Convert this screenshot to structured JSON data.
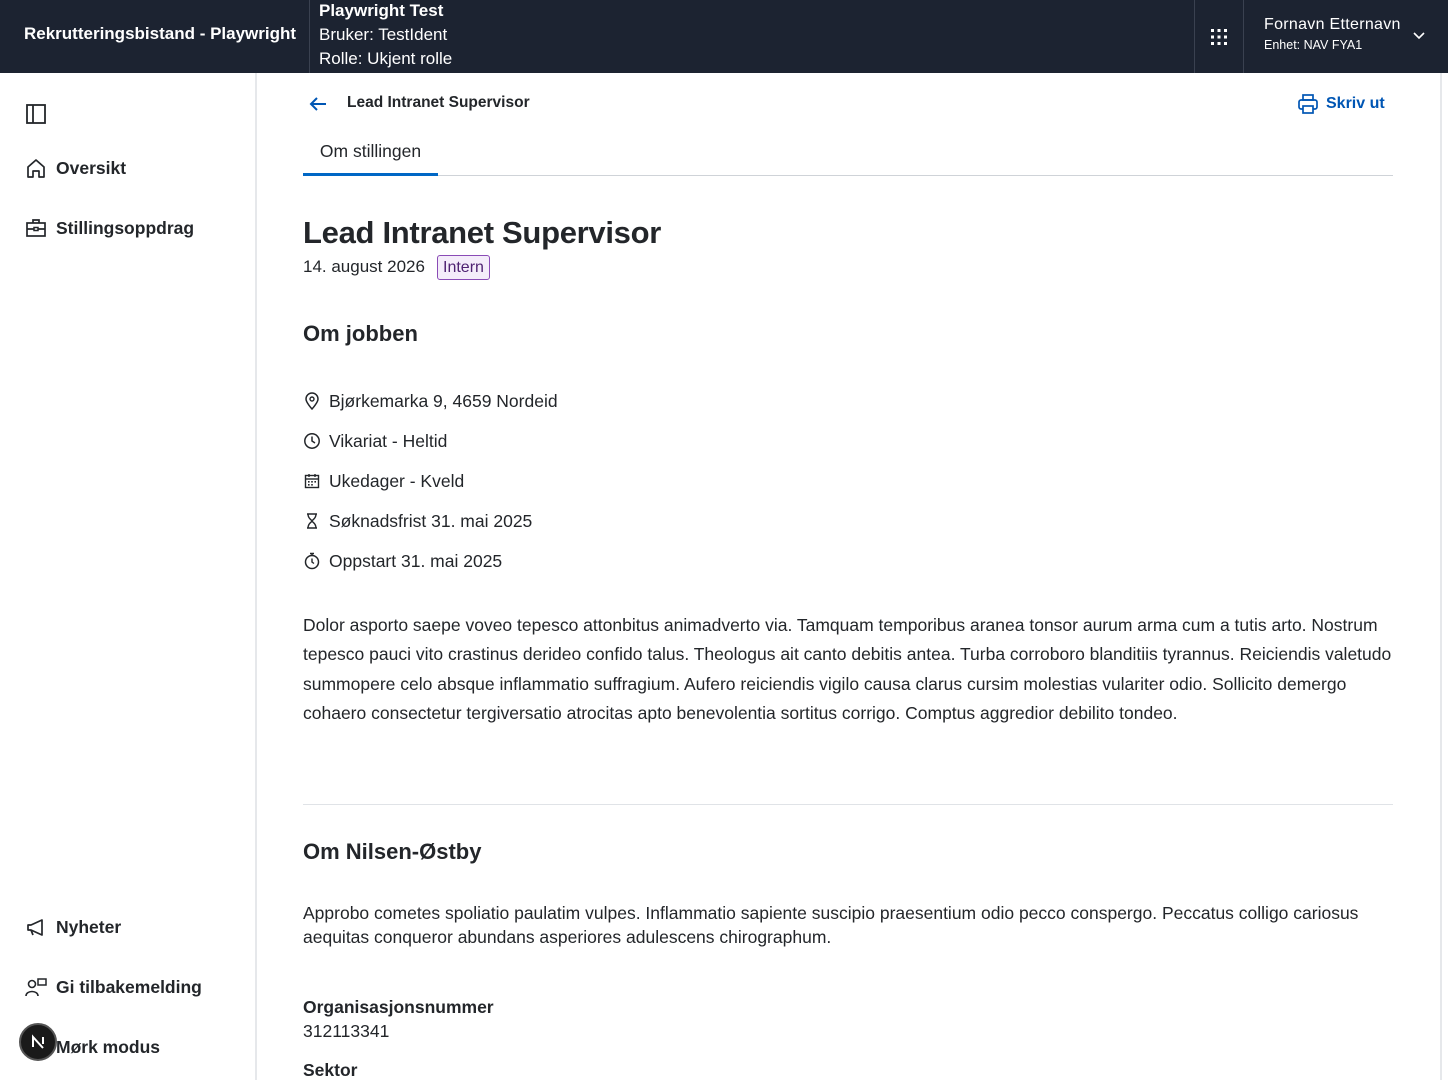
{
  "header": {
    "app_title": "Rekrutteringsbistand - Playwright",
    "env_title": "Playwright Test",
    "env_user": "Bruker: TestIdent",
    "env_role": "Rolle: Ukjent rolle",
    "user_name": "Fornavn Etternavn",
    "user_unit": "Enhet: NAV FYA1"
  },
  "sidebar": {
    "items": [
      {
        "label": "Oversikt",
        "icon": "house-icon"
      },
      {
        "label": "Stillingsoppdrag",
        "icon": "briefcase-icon"
      }
    ],
    "bottom_items": [
      {
        "label": "Nyheter",
        "icon": "megaphone-icon"
      },
      {
        "label": "Gi tilbakemelding",
        "icon": "feedback-icon"
      },
      {
        "label": "Mørk modus",
        "icon": "moon-icon"
      }
    ]
  },
  "main": {
    "breadcrumb_title": "Lead Intranet Supervisor",
    "print_label": "Skriv ut",
    "tabs": [
      {
        "label": "Om stillingen"
      }
    ],
    "job_title": "Lead Intranet Supervisor",
    "date": "14. august 2026",
    "tag": "Intern",
    "about_job_heading": "Om jobben",
    "facts": [
      {
        "icon": "location-pin-icon",
        "text": "Bjørkemarka 9, 4659 Nordeid"
      },
      {
        "icon": "clock-icon",
        "text": "Vikariat - Heltid"
      },
      {
        "icon": "calendar-icon",
        "text": "Ukedager - Kveld"
      },
      {
        "icon": "hourglass-icon",
        "text": "Søknadsfrist 31. mai 2025"
      },
      {
        "icon": "stopwatch-icon",
        "text": "Oppstart 31. mai 2025"
      }
    ],
    "description": "Dolor asporto saepe voveo tepesco attonbitus animadverto via. Tamquam temporibus aranea tonsor aurum arma cum a tutis arto. Nostrum tepesco pauci vito crastinus derideo confido talus. Theologus ait canto debitis antea. Turba corroboro blanditiis tyrannus. Reiciendis valetudo summopere celo absque inflammatio suffragium. Aufero reiciendis vigilo causa clarus cursim molestias vulariter odio. Sollicito demergo cohaero consectetur tergiversatio atrocitas apto benevolentia sortitus corrigo. Comptus aggredior debilito tondeo.",
    "company_heading": "Om Nilsen-Østby",
    "company_description": "Approbo cometes spoliatio paulatim vulpes. Inflammatio sapiente suscipio praesentium odio pecco conspergo. Peccatus colligo cariosus aequitas conqueror abundans asperiores adulescens chirographum.",
    "org_number_label": "Organisasjonsnummer",
    "org_number_value": "312113341",
    "sector_label": "Sektor"
  },
  "colors": {
    "header_bg": "#1c2331",
    "accent": "#0067c5",
    "link": "#0056b4",
    "tag_border": "#8a4bb6",
    "tag_bg": "#f4ecfa"
  }
}
